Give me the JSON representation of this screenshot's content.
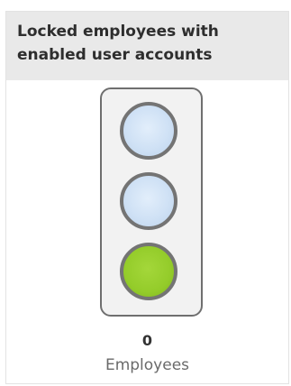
{
  "tile": {
    "title": "Locked employees with enabled user accounts",
    "value": "0",
    "unit": "Employees",
    "indicator": {
      "type": "traffic-light",
      "lamps": [
        {
          "position": "top",
          "state": "off",
          "color": "#cfe1f5"
        },
        {
          "position": "middle",
          "state": "off",
          "color": "#cfe1f5"
        },
        {
          "position": "bottom",
          "state": "on",
          "color": "#94cc2a"
        }
      ]
    }
  }
}
